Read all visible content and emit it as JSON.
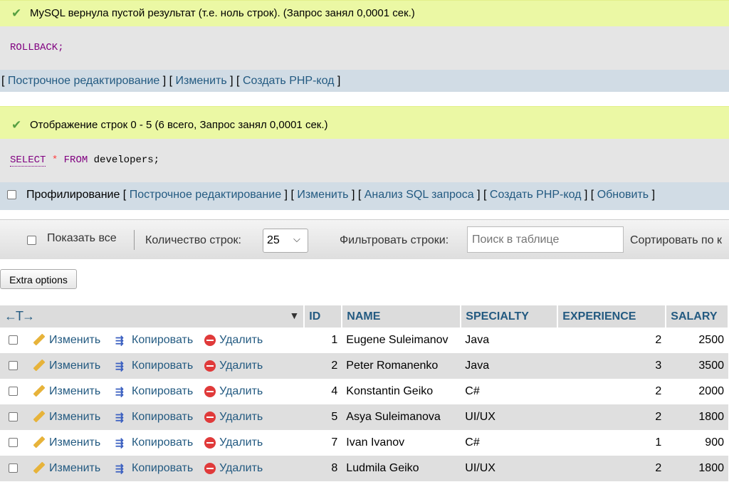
{
  "block1": {
    "message": "MySQL вернула пустой результат (т.е. ноль строк). (Запрос занял 0,0001 сек.)",
    "sql": "ROLLBACK;",
    "links": [
      "Построчное редактирование",
      "Изменить",
      "Создать PHP-код"
    ]
  },
  "block2": {
    "message": "Отображение строк 0 - 5 (6 всего, Запрос занял 0,0001 сек.)",
    "sql_select": "SELECT",
    "sql_star": "*",
    "sql_from": "FROM",
    "sql_table": "developers;",
    "profiling_label": "Профилирование",
    "links": [
      "Построчное редактирование",
      "Изменить",
      "Анализ SQL запроса",
      "Создать PHP-код",
      "Обновить"
    ]
  },
  "navbar": {
    "show_all": "Показать все",
    "rows_label": "Количество строк:",
    "rows_value": "25",
    "filter_label": "Фильтровать строки:",
    "filter_placeholder": "Поиск в таблице",
    "sort_label": "Сортировать по к"
  },
  "extra_options": "Extra options",
  "table": {
    "arrows": "←T→",
    "columns": [
      "ID",
      "NAME",
      "SPECIALTY",
      "EXPERIENCE",
      "SALARY"
    ],
    "actions": {
      "edit": "Изменить",
      "copy": "Копировать",
      "delete": "Удалить"
    },
    "rows": [
      {
        "id": "1",
        "name": "Eugene Suleimanov",
        "specialty": "Java",
        "experience": "2",
        "salary": "2500"
      },
      {
        "id": "2",
        "name": "Peter Romanenko",
        "specialty": "Java",
        "experience": "3",
        "salary": "3500"
      },
      {
        "id": "4",
        "name": "Konstantin Geiko",
        "specialty": "C#",
        "experience": "2",
        "salary": "2000"
      },
      {
        "id": "5",
        "name": "Asya Suleimanova",
        "specialty": "UI/UX",
        "experience": "2",
        "salary": "1800"
      },
      {
        "id": "7",
        "name": "Ivan Ivanov",
        "specialty": "C#",
        "experience": "1",
        "salary": "900"
      },
      {
        "id": "8",
        "name": "Ludmila Geiko",
        "specialty": "UI/UX",
        "experience": "2",
        "salary": "1800"
      }
    ]
  },
  "colors": {
    "success_bg": "#ebf8a4",
    "link": "#235a81",
    "sql_bg": "#e5e5e5",
    "links_bg": "#d1dce5"
  }
}
